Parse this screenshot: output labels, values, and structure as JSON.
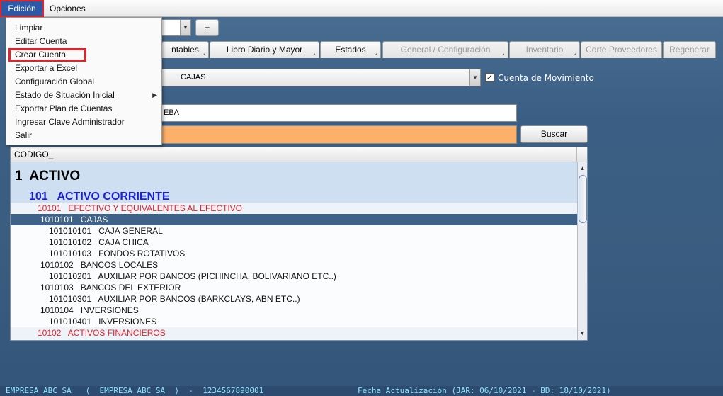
{
  "menubar": {
    "edicion": "Edición",
    "opciones": "Opciones"
  },
  "dropdown": {
    "items": [
      "Limpiar",
      "Editar Cuenta",
      "Crear Cuenta",
      "Exportar a Excel",
      "Configuración Global",
      "Estado de Situación Inicial",
      "Exportar Plan de Cuentas",
      "Ingresar Clave Administrador",
      "Salir"
    ]
  },
  "toolbar": {
    "plus_label": "+"
  },
  "tabs": [
    {
      "label": "ntables"
    },
    {
      "label": "Libro Diario y Mayor"
    },
    {
      "label": "Estados"
    },
    {
      "label": "General / Configuración"
    },
    {
      "label": "Inventario"
    },
    {
      "label": "Corte Proveedores"
    },
    {
      "label": "Regenerar"
    }
  ],
  "account_combo": {
    "value": "CAJAS"
  },
  "movement_checkbox": {
    "label": "Cuenta de Movimiento",
    "checked": true
  },
  "text_field": {
    "value": "EBA"
  },
  "search": {
    "value": "",
    "button_label": "Buscar"
  },
  "tree": {
    "header": "CODIGO_",
    "rows": [
      {
        "text": "1  ACTIVO",
        "level": 1
      },
      {
        "text": "101   ACTIVO CORRIENTE",
        "level": 2
      },
      {
        "text": "10101   EFECTIVO Y EQUIVALENTES AL EFECTIVO",
        "level": 3
      },
      {
        "text": "1010101   CAJAS",
        "level": 4,
        "selected": true
      },
      {
        "text": "101010101   CAJA GENERAL",
        "level": 5
      },
      {
        "text": "101010102   CAJA CHICA",
        "level": 5
      },
      {
        "text": "101010103   FONDOS ROTATIVOS",
        "level": 5
      },
      {
        "text": "1010102   BANCOS LOCALES",
        "level": 4
      },
      {
        "text": "101010201   AUXILIAR POR BANCOS (PICHINCHA, BOLIVARIANO ETC..)",
        "level": 5
      },
      {
        "text": "1010103   BANCOS DEL EXTERIOR",
        "level": 4
      },
      {
        "text": "101010301   AUXILIAR POR BANCOS (BARKCLAYS, ABN ETC..)",
        "level": 5
      },
      {
        "text": "1010104   INVERSIONES",
        "level": 4
      },
      {
        "text": "101010401   INVERSIONES",
        "level": 5
      },
      {
        "text": "10102   ACTIVOS FINANCIEROS",
        "level": 3
      }
    ]
  },
  "statusbar": {
    "company": "EMPRESA ABC SA   (  EMPRESA ABC SA  )  -  1234567890001",
    "updated": "Fecha Actualización (JAR: 06/10/2021 - BD: 18/10/2021)"
  },
  "colors": {
    "accent_selected_menu": "#2b5aa8",
    "highlight_red": "#e0252a",
    "search_orange": "#fcb06a",
    "level2_blue": "#1a1fd6",
    "selected_row": "#3f6388",
    "status_text": "#8ce4ff"
  }
}
